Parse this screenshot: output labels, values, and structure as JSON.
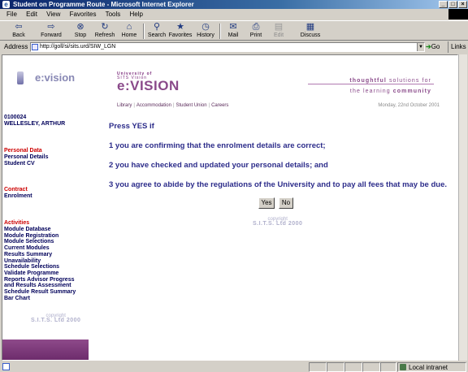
{
  "window": {
    "title": "Student on Programme Route - Microsoft Internet Explorer",
    "controls": [
      "_",
      "□",
      "×"
    ]
  },
  "menu": [
    "File",
    "Edit",
    "View",
    "Favorites",
    "Tools",
    "Help"
  ],
  "toolbar": {
    "back": "Back",
    "forward": "Forward",
    "stop": "Stop",
    "refresh": "Refresh",
    "home": "Home",
    "search": "Search",
    "favorites": "Favorites",
    "history": "History",
    "mail": "Mail",
    "print": "Print",
    "edit": "Edit",
    "discuss": "Discuss"
  },
  "address": {
    "label": "Address",
    "url": "http://goll/si/sits.urd/SIW_LGN",
    "go": "Go",
    "links": "Links"
  },
  "leftnav": {
    "logo": "e:vision",
    "student_id": "0100024",
    "student_name": "WELLESLEY, ARTHUR",
    "personal_head": "Personal Data",
    "personal_items": [
      "Personal Details",
      "Student CV"
    ],
    "contract_head": "Contract",
    "contract_items": [
      "Enrolment"
    ],
    "activities_head": "Activities",
    "activities_items": [
      "Module Database",
      "Module Registration",
      "Module Selections",
      "Current Modules",
      "Results Summary",
      "Unavailability",
      "Schedule Selections",
      "Validate Programme",
      "Reports Advisor Progress",
      "and Results Assessment",
      "Schedule Result Summary",
      "Bar Chart"
    ],
    "copyright_small": "copyright",
    "copyright": "S.I.T.S. Ltd 2000"
  },
  "header": {
    "logo_line1": "University of",
    "logo_line2": "SITS Vision",
    "logo_main": "e:VISION",
    "tagline_thoughtful": "thoughtful",
    "tagline_rest": " solutions for",
    "tagline_line2": "the learning ",
    "tagline_community": "community",
    "links": [
      "Library",
      "Accommodation",
      "Student Union",
      "Careers"
    ],
    "date": "Monday, 22nd October 2001"
  },
  "main": {
    "line1": "Press YES if",
    "line2": "1 you are confirming that the enrolment details are correct;",
    "line3": "2 you have checked and updated your personal details; and",
    "line4": "3 you agree to abide by the regulations of the University and to pay all fees that may be due.",
    "yes": "Yes",
    "no": "No",
    "copyright_small": "copyright",
    "copyright": "S.I.T.S. Ltd 2000"
  },
  "status": {
    "zone": "Local intranet"
  }
}
